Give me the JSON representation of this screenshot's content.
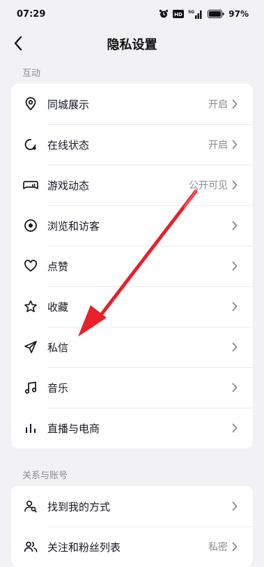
{
  "status_bar": {
    "time": "07:29",
    "battery": "97%",
    "network": "5G"
  },
  "nav": {
    "title": "隐私设置"
  },
  "section1": {
    "label": "互动",
    "items": [
      {
        "label": "同城展示",
        "value": "开启",
        "icon": "location-pin-icon"
      },
      {
        "label": "在线状态",
        "value": "开启",
        "icon": "online-status-icon"
      },
      {
        "label": "游戏动态",
        "value": "公开可见",
        "icon": "game-controller-icon"
      },
      {
        "label": "浏览和访客",
        "value": "",
        "icon": "eye-icon"
      },
      {
        "label": "点赞",
        "value": "",
        "icon": "heart-icon"
      },
      {
        "label": "收藏",
        "value": "",
        "icon": "star-icon"
      },
      {
        "label": "私信",
        "value": "",
        "icon": "paper-plane-icon"
      },
      {
        "label": "音乐",
        "value": "",
        "icon": "music-note-icon"
      },
      {
        "label": "直播与电商",
        "value": "",
        "icon": "bars-icon"
      }
    ]
  },
  "section2": {
    "label": "关系与账号",
    "items": [
      {
        "label": "找到我的方式",
        "value": "",
        "icon": "find-user-icon"
      },
      {
        "label": "关注和粉丝列表",
        "value": "私密",
        "icon": "followers-icon"
      }
    ]
  },
  "colors": {
    "accent_arrow": "#e8202a",
    "background": "#f2f2f4",
    "card": "#ffffff",
    "secondary_text": "#8a8b91"
  }
}
